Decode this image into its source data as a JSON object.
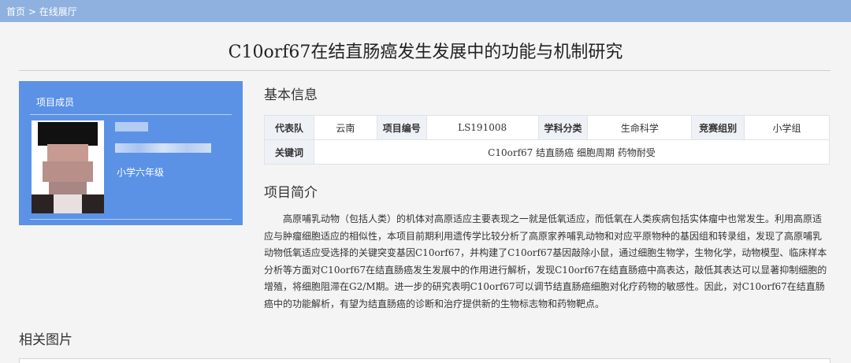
{
  "breadcrumb": {
    "home": "首页",
    "separator": " > ",
    "current": "在线展厅"
  },
  "project_title": "C10orf67在结直肠癌发生发展中的功能与机制研究",
  "member": {
    "heading": "项目成员",
    "grade": "小学六年级"
  },
  "basic_info": {
    "heading": "基本信息",
    "rows": [
      [
        {
          "label": "代表队",
          "value": "云南"
        },
        {
          "label": "项目编号",
          "value": "LS191008"
        },
        {
          "label": "学科分类",
          "value": "生命科学"
        },
        {
          "label": "竞赛组别",
          "value": "小学组"
        }
      ]
    ],
    "keywords_label": "关键词",
    "keywords": "C10orf67 结直肠癌 细胞周期 药物耐受"
  },
  "intro": {
    "heading": "项目简介",
    "text": "高原哺乳动物（包括人类）的机体对高原适应主要表现之一就是低氧适应，而低氧在人类疾病包括实体瘤中也常发生。利用高原适应与肿瘤细胞适应的相似性，本项目前期利用遗传学比较分析了高原家养哺乳动物和对应平原物种的基因组和转录组，发现了高原哺乳动物低氧适应受选择的关键突变基因C10orf67，并构建了C10orf67基因敲除小鼠，通过细胞生物学，生物化学，动物模型、临床样本分析等方面对C10orf67在结直肠癌发生发展中的作用进行解析，发现C10orf67在结直肠癌中高表达，敲低其表达可以显著抑制细胞的增殖，将细胞阻滞在G2/M期。进一步的研究表明C10orf67可以调节结直肠癌细胞对化疗药物的敏感性。因此，对C10orf67在结直肠癌中的功能解析，有望为结直肠癌的诊断和治疗提供新的生物标志物和药物靶点。"
  },
  "related": {
    "heading": "相关图片"
  }
}
